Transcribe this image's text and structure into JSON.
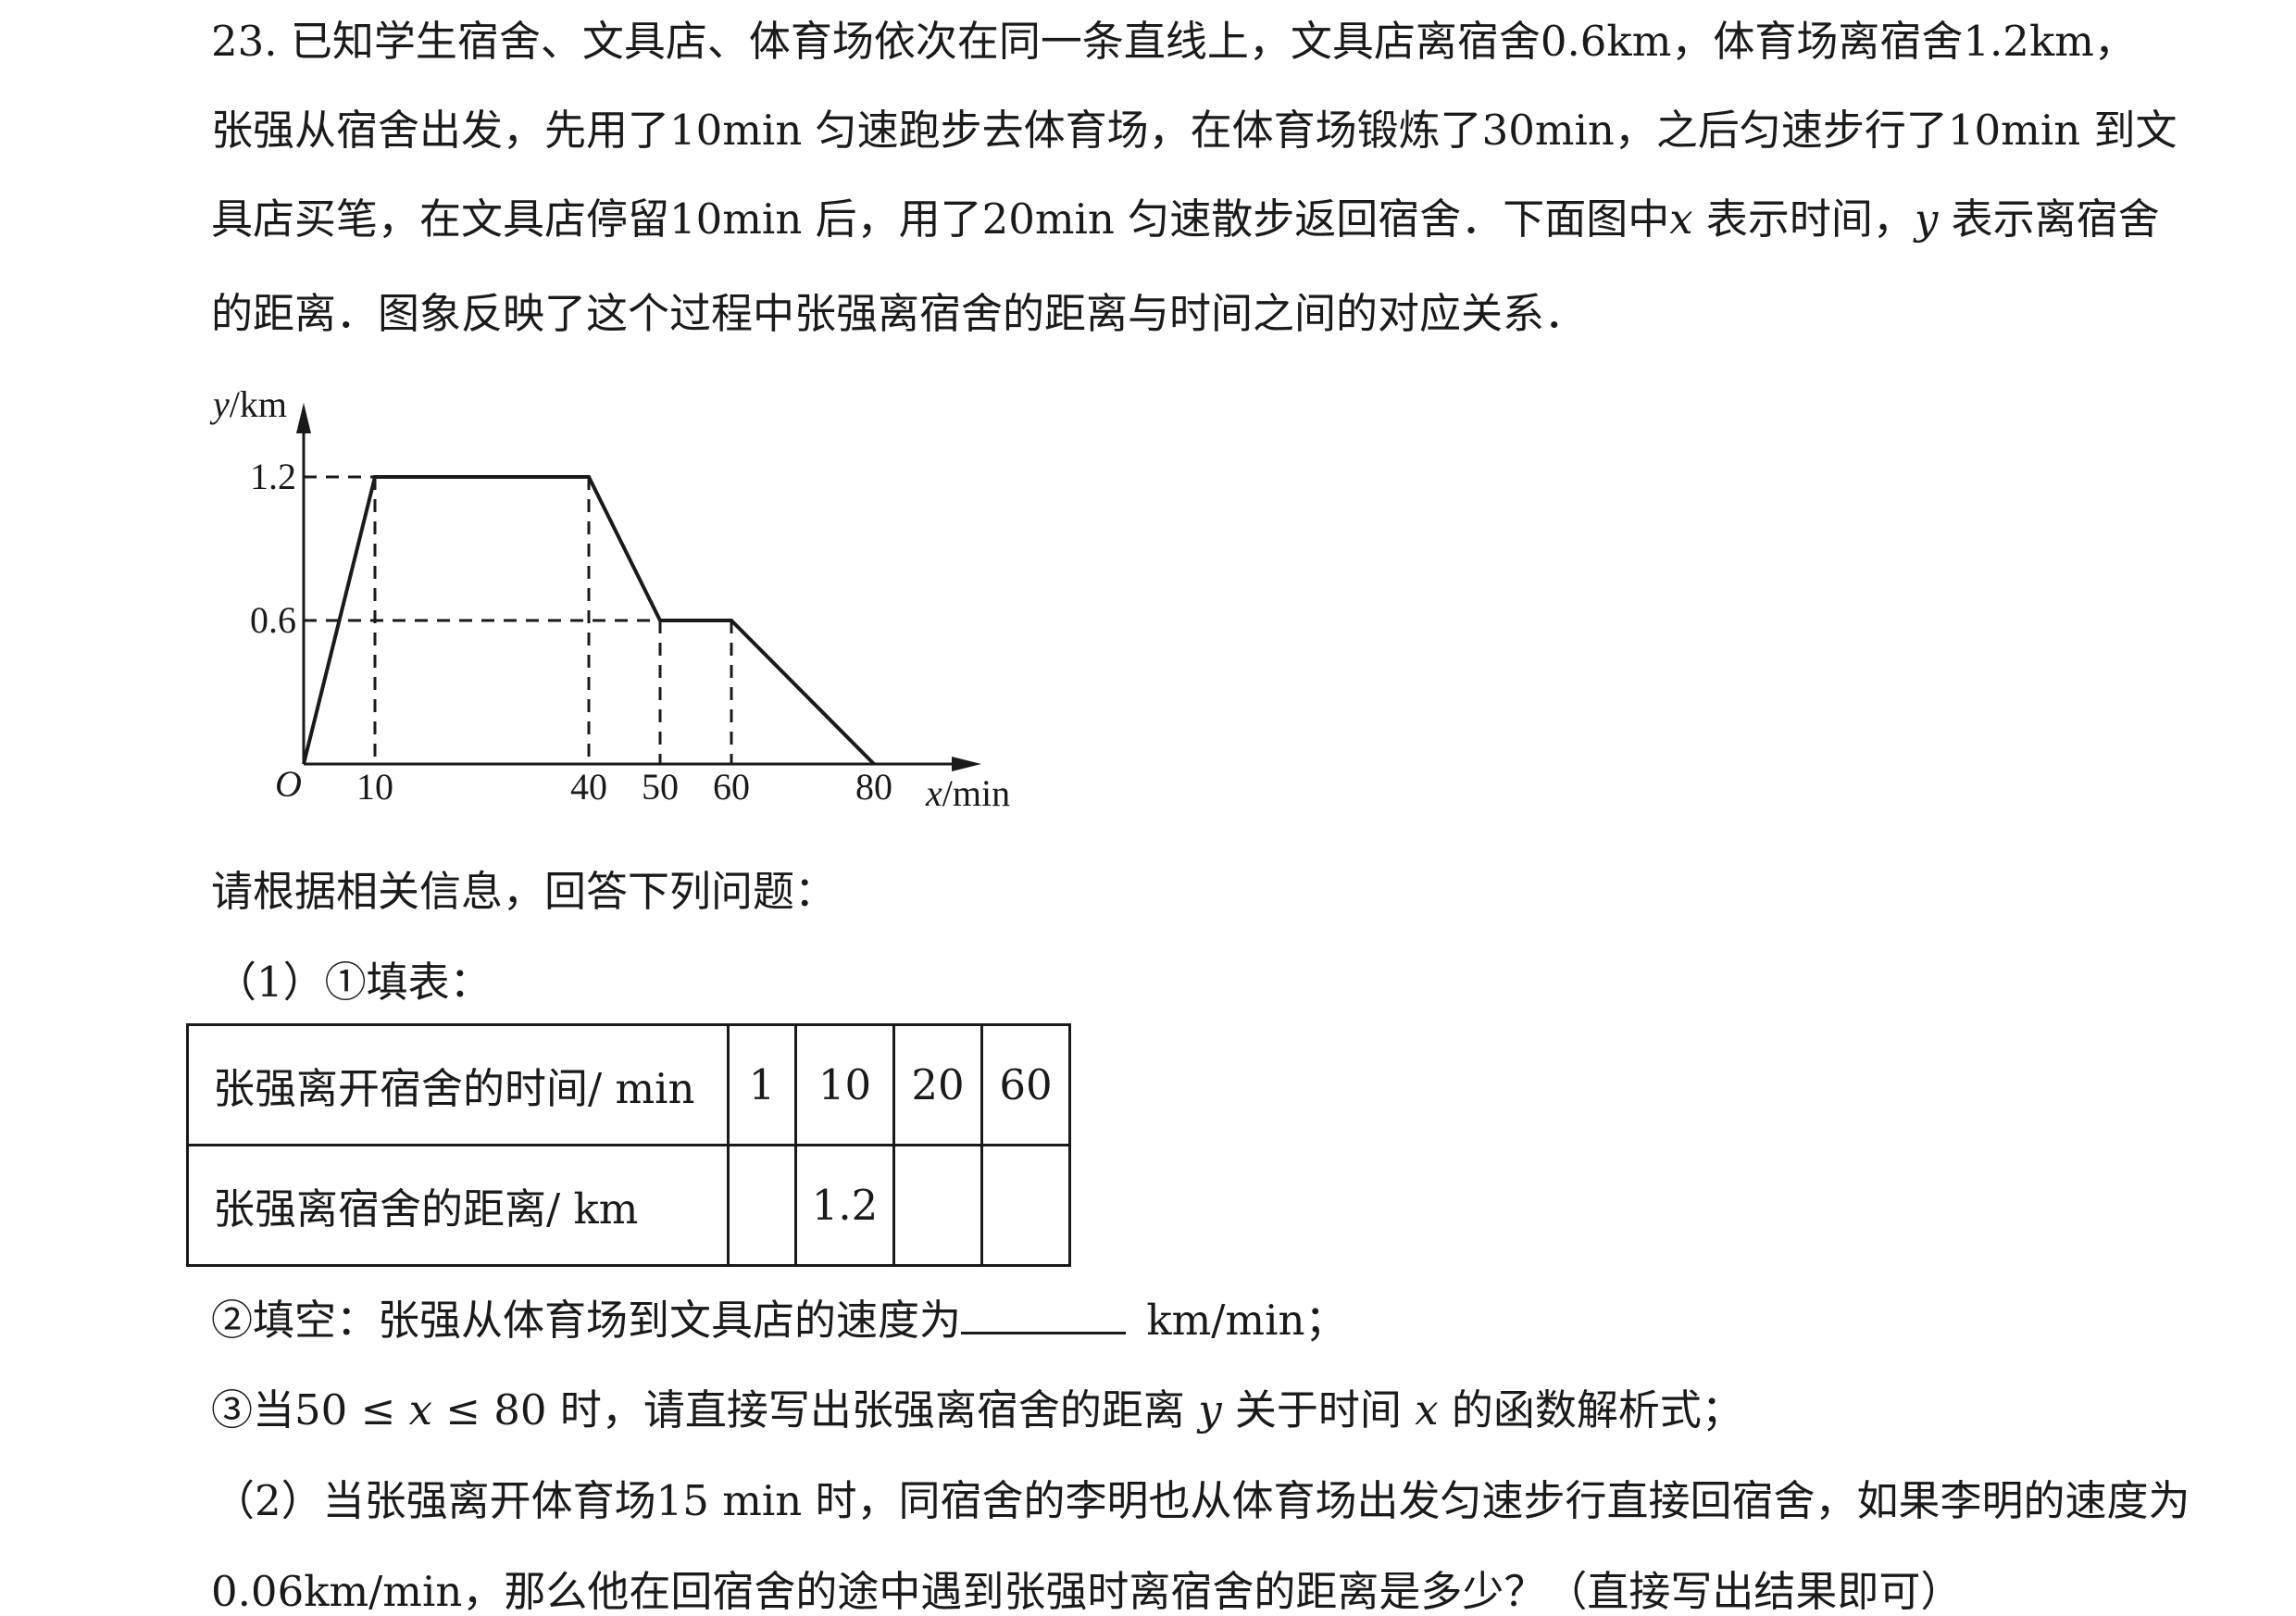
{
  "problem": {
    "p1": "23. 已知学生宿舍、文具店、体育场依次在同一条直线上，文具店离宿舍0.6km，体育场离宿舍1.2km，",
    "p2": "张强从宿舍出发，先用了10min 匀速跑步去体育场，在体育场锻炼了30min，之后匀速步行了10min 到文",
    "p3a": "具店买笔，在文具店停留10min 后，用了20min 匀速散步返回宿舍．下面图中",
    "p3x": "x",
    "p3b": " 表示时间，",
    "p3y": "y",
    "p3c": " 表示离宿舍",
    "p4": "的距离．图象反映了这个过程中张强离宿舍的距离与时间之间的对应关系．"
  },
  "graph": {
    "y_axis_label_var": "y",
    "y_axis_label_unit": "/km",
    "x_axis_label_var": "x",
    "x_axis_label_unit": "/min",
    "origin_label": "O",
    "y_tick_labels": [
      "1.2",
      "0.6"
    ],
    "x_tick_labels": [
      "10",
      "40",
      "50",
      "60",
      "80"
    ]
  },
  "chart_data": {
    "type": "line",
    "xlabel": "x/min",
    "ylabel": "y/km",
    "x": [
      0,
      10,
      40,
      50,
      60,
      80
    ],
    "series": [
      {
        "values": [
          0,
          1.2,
          1.2,
          0.6,
          0.6,
          0
        ]
      }
    ],
    "xlim": [
      0,
      80
    ],
    "ylim": [
      0,
      1.2
    ],
    "x_ticks": [
      10,
      40,
      50,
      60,
      80
    ],
    "y_ticks": [
      0.6,
      1.2
    ],
    "grid": false,
    "guides": "dashed"
  },
  "questions": {
    "intro": "请根据相关信息，回答下列问题：",
    "q1_label": "（1）①填表：",
    "table": {
      "row1_header": "张强离开宿舍的时间/ min",
      "row1": [
        "1",
        "10",
        "20",
        "60"
      ],
      "row2_header": "张强离宿舍的距离/ km",
      "row2": [
        "",
        "1.2",
        "",
        ""
      ]
    },
    "q2_before": "②填空：张强从体育场到文具店的速度为",
    "q2_after": " km/min；",
    "q3_a": "③当",
    "q3_ineq_1": "50 ≤ ",
    "q3_ineq_x": "x",
    "q3_ineq_2": " ≤ 80",
    "q3_b": " 时，请直接写出张强离宿舍的距离 ",
    "q3_y": "y",
    "q3_c": " 关于时间 ",
    "q3_x": "x",
    "q3_d": " 的函数解析式；",
    "part2_line1": "（2）当张强离开体育场15 min 时，同宿舍的李明也从体育场出发匀速步行直接回宿舍，如果李明的速度为",
    "part2_line2": "0.06km/min，那么他在回宿舍的途中遇到张强时离宿舍的距离是多少？（直接写出结果即可）"
  }
}
